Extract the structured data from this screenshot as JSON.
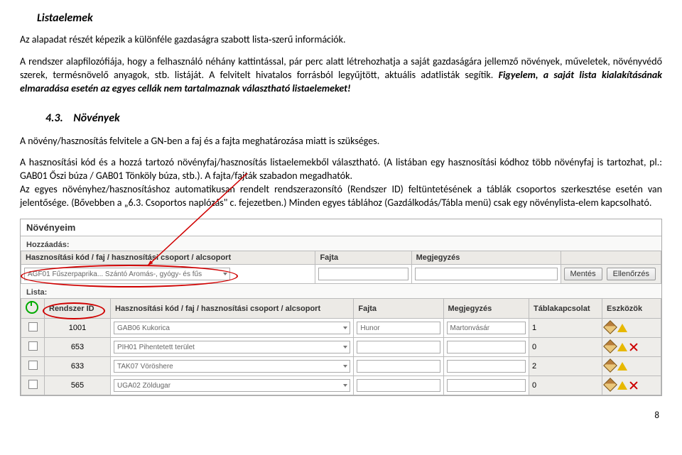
{
  "headings": {
    "list_elements": "Listaelemek",
    "section_number": "4.3.",
    "section_title": "Növények"
  },
  "paragraphs": {
    "p1_a": "Az alapadat részét képezik a különféle gazdaságra szabott lista‐szerű információk.",
    "p1_b": "A rendszer alapfilozófiája, hogy a felhasználó néhány kattintással, pár perc alatt létrehozhatja a saját gazdaságára jellemző növények, műveletek, növényvédő szerek, termésnövelő anyagok, stb. listáját. A felvitelt hivatalos forrásból legyűjtött, aktuális adatlisták segítik. ",
    "p1_c": "Figyelem, a saját lista kialakításának elmaradása esetén az egyes cellák nem tartalmaznak választható listaelemeket!",
    "p2_a": "A növény/hasznosítás felvitele a GN‐ben a faj és a fajta meghatározása miatt is szükséges.",
    "p2_b": "A hasznosítási kód és a hozzá tartozó növényfaj/hasznosítás listaelemekből választható. (A listában egy hasznosítási kódhoz több növényfaj is tartozhat, pl.: GAB01 Őszi búza / GAB01 Tönköly búza, stb.). A fajta/fajták szabadon megadhatók.",
    "p2_c": "Az egyes növényhez/hasznosításhoz automatikusan rendelt rendszerazonsító (Rendszer ID) feltüntetésének a táblák csoportos szerkesztése esetén van jelentősége. (Bővebben a „6.3. Csoportos naplózás\" c. fejezetben.) Minden egyes táblához (Gazdálkodás/Tábla menü) csak egy növénylista‐elem kapcsolható."
  },
  "panel": {
    "title": "Növényeim",
    "add_label": "Hozzáadás:",
    "list_label": "Lista:",
    "add_headers": {
      "kod": "Hasznosítási kód / faj / hasznosítási csoport / alcsoport",
      "fajta": "Fajta",
      "megj": "Megjegyzés"
    },
    "add_row": {
      "kod_value": "AGF01 Fűszerpaprika... Szántó Aromás-, gyógy- és fűs"
    },
    "buttons": {
      "save": "Mentés",
      "check": "Ellenőrzés"
    },
    "list_headers": {
      "rid": "Rendszer ID",
      "kod": "Hasznosítási kód / faj / hasznosítási csoport / alcsoport",
      "fajta": "Fajta",
      "megj": "Megjegyzés",
      "tabla": "Táblakapcsolat",
      "tools": "Eszközök"
    },
    "rows": [
      {
        "rid": "1001",
        "kod": "GAB06 Kukorica",
        "fajta": "Hunor",
        "megj": "Martonvásár",
        "tabla": "1",
        "warn": true,
        "del": false
      },
      {
        "rid": "653",
        "kod": "PIH01 Pihentetett terület",
        "fajta": "",
        "megj": "",
        "tabla": "0",
        "warn": true,
        "del": true
      },
      {
        "rid": "633",
        "kod": "TAK07 Vöröshere",
        "fajta": "",
        "megj": "",
        "tabla": "2",
        "warn": true,
        "del": false
      },
      {
        "rid": "565",
        "kod": "UGA02 Zöldugar",
        "fajta": "",
        "megj": "",
        "tabla": "0",
        "warn": true,
        "del": true
      }
    ]
  },
  "page_number": "8"
}
